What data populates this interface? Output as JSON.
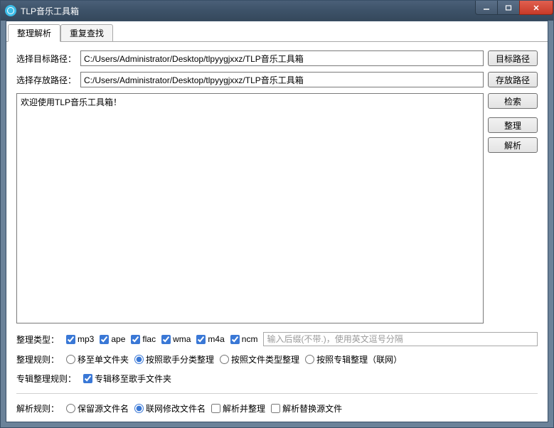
{
  "window": {
    "title": "TLP音乐工具箱"
  },
  "tabs": {
    "active": "整理解析",
    "inactive": "重复查找"
  },
  "paths": {
    "target_label": "选择目标路径：",
    "target_value": "C:/Users/Administrator/Desktop/tlpyygjxxz/TLP音乐工具箱",
    "target_btn": "目标路径",
    "save_label": "选择存放路径：",
    "save_value": "C:/Users/Administrator/Desktop/tlpyygjxxz/TLP音乐工具箱",
    "save_btn": "存放路径"
  },
  "log": {
    "text": "欢迎使用TLP音乐工具箱！"
  },
  "buttons": {
    "search": "检索",
    "organize": "整理",
    "parse": "解析"
  },
  "file_types": {
    "label": "整理类型：",
    "items": [
      {
        "label": "mp3",
        "checked": true
      },
      {
        "label": "ape",
        "checked": true
      },
      {
        "label": "flac",
        "checked": true
      },
      {
        "label": "wma",
        "checked": true
      },
      {
        "label": "m4a",
        "checked": true
      },
      {
        "label": "ncm",
        "checked": true
      }
    ],
    "ext_placeholder": "输入后缀(不带.)，使用英文逗号分隔"
  },
  "organize_rules": {
    "label": "整理规则：",
    "items": [
      {
        "label": "移至单文件夹",
        "checked": false
      },
      {
        "label": "按照歌手分类整理",
        "checked": true
      },
      {
        "label": "按照文件类型整理",
        "checked": false
      },
      {
        "label": "按照专辑整理（联网）",
        "checked": false
      }
    ]
  },
  "album_rule": {
    "label": "专辑整理规则：",
    "checkbox": "专辑移至歌手文件夹",
    "checked": true
  },
  "parse_rules": {
    "label": "解析规则：",
    "radios": [
      {
        "label": "保留源文件名",
        "checked": false
      },
      {
        "label": "联网修改文件名",
        "checked": true
      }
    ],
    "checks": [
      {
        "label": "解析并整理",
        "checked": false
      },
      {
        "label": "解析替换源文件",
        "checked": false
      }
    ]
  }
}
